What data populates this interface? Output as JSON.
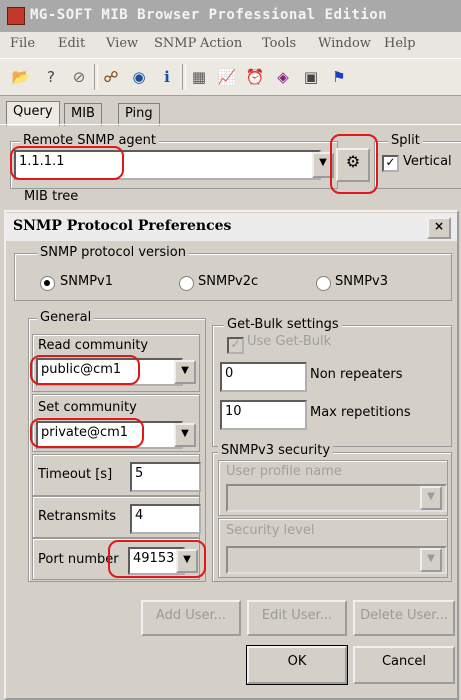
{
  "window": {
    "title": "MG-SOFT MIB Browser Professional Edition"
  },
  "menu": [
    {
      "label": "File",
      "key": "F"
    },
    {
      "label": "Edit",
      "key": "E"
    },
    {
      "label": "View",
      "key": "V"
    },
    {
      "label": "SNMP",
      "key": "N"
    },
    {
      "label": "Action",
      "key": "c"
    },
    {
      "label": "Tools",
      "key": "T"
    },
    {
      "label": "Window",
      "key": "W"
    },
    {
      "label": "Help",
      "key": "H"
    }
  ],
  "toolbar": {
    "icons": [
      "open-icon",
      "help-icon",
      "stop-icon",
      "tree-icon",
      "globe-icon",
      "info-icon",
      "table-icon",
      "graph-icon",
      "alarm-icon",
      "trap-icon",
      "device-icon",
      "flag-icon"
    ],
    "glyphs": [
      "📂",
      "?",
      "⊘",
      "☍",
      "◉",
      "i",
      "▦",
      "📈",
      "⏰",
      "◈",
      "▣",
      "⚑"
    ]
  },
  "tabs": {
    "query": "Query",
    "mib": "MIB",
    "ping": "Ping"
  },
  "agent": {
    "group_label": "Remote SNMP agent",
    "value": "1.1.1.1",
    "split_label": "Split",
    "vertical_label": "Vertical",
    "vertical_checked": true
  },
  "mib_tree_label": "MIB tree",
  "dialog": {
    "title": "SNMP Protocol Preferences",
    "close": "×",
    "version": {
      "group_label": "SNMP protocol version",
      "options": [
        "SNMPv1",
        "SNMPv2c",
        "SNMPv3"
      ],
      "selected": "SNMPv1"
    },
    "general": {
      "group_label": "General",
      "read_label": "Read community",
      "read_value": "public@cm1",
      "set_label": "Set community",
      "set_value": "private@cm1",
      "timeout_label": "Timeout [s]",
      "timeout_value": "5",
      "retransmits_label": "Retransmits",
      "retransmits_value": "4",
      "port_label": "Port number",
      "port_value": "49153"
    },
    "bulk": {
      "group_label": "Get-Bulk settings",
      "use_label": "Use Get-Bulk",
      "non_repeaters_value": "0",
      "non_repeaters_label": "Non repeaters",
      "max_rep_value": "10",
      "max_rep_label": "Max repetitions"
    },
    "v3": {
      "group_label": "SNMPv3 security",
      "user_profile_label": "User profile name",
      "security_level_label": "Security level"
    },
    "buttons": {
      "add_user": "Add User...",
      "edit_user": "Edit User...",
      "delete_user": "Delete User...",
      "ok": "OK",
      "cancel": "Cancel"
    }
  },
  "colors": {
    "highlight": "#e01818",
    "title_bar": "#a9a9a9"
  }
}
